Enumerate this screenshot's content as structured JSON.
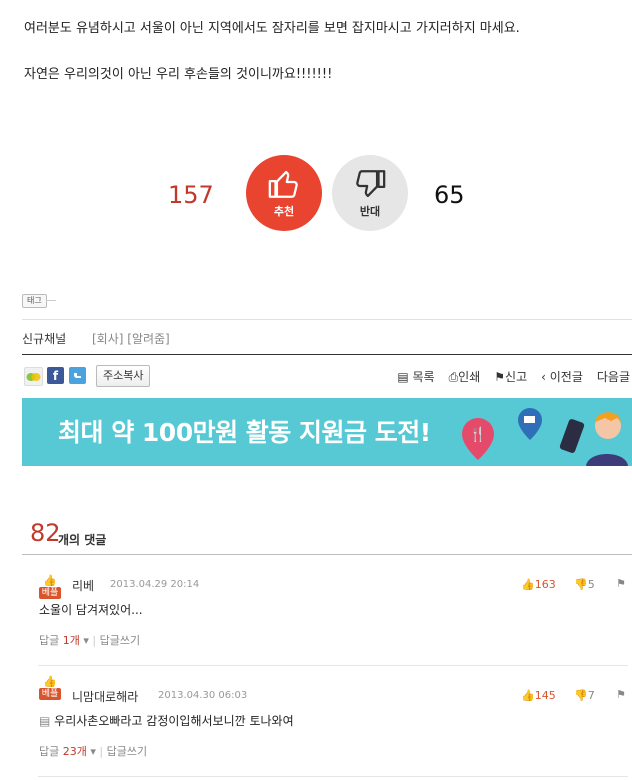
{
  "article": {
    "line1": "여러분도 유념하시고 서울이 아닌 지역에서도 잠자리를 보면 잡지마시고 가지러하지 마세요.",
    "line2": "자연은 우리의것이 아닌 우리 후손들의 것이니까요!!!!!!!"
  },
  "vote": {
    "up_count": "157",
    "up_label": "추천",
    "down_label": "반대",
    "down_count": "65",
    "up_color": "#e8442f",
    "down_color": "#e6e6e6"
  },
  "tags": {
    "badge": "태그"
  },
  "channel": {
    "label": "신규채널",
    "tags": "[회사] [알려줌]"
  },
  "share": {
    "copy_label": "주소복사"
  },
  "toolbar": {
    "list": "목록",
    "print": "인쇄",
    "report": "신고",
    "prev": "이전글",
    "next": "다음글"
  },
  "banner": {
    "text": "최대 약 100만원 활동 지원금 도전!",
    "bg": "#56c9d4"
  },
  "comments_header": {
    "count": "82",
    "label": "개의 댓글"
  },
  "comments": [
    {
      "badge": "베플",
      "name": "리베",
      "date": "2013.04.29 20:14",
      "likes": "163",
      "dislikes": "5",
      "body": "소울이 담겨져있어...",
      "reply_prefix": "답글",
      "reply_count": "1개",
      "write_reply": "답글쓰기"
    },
    {
      "badge": "베플",
      "name": "니맘대로해라",
      "date": "2013.04.30 06:03",
      "likes": "145",
      "dislikes": "7",
      "body": "우리사촌오빠라고 감정이입해서보니깐 토나와여",
      "reply_prefix": "답글",
      "reply_count": "23개",
      "write_reply": "답글쓰기"
    }
  ]
}
